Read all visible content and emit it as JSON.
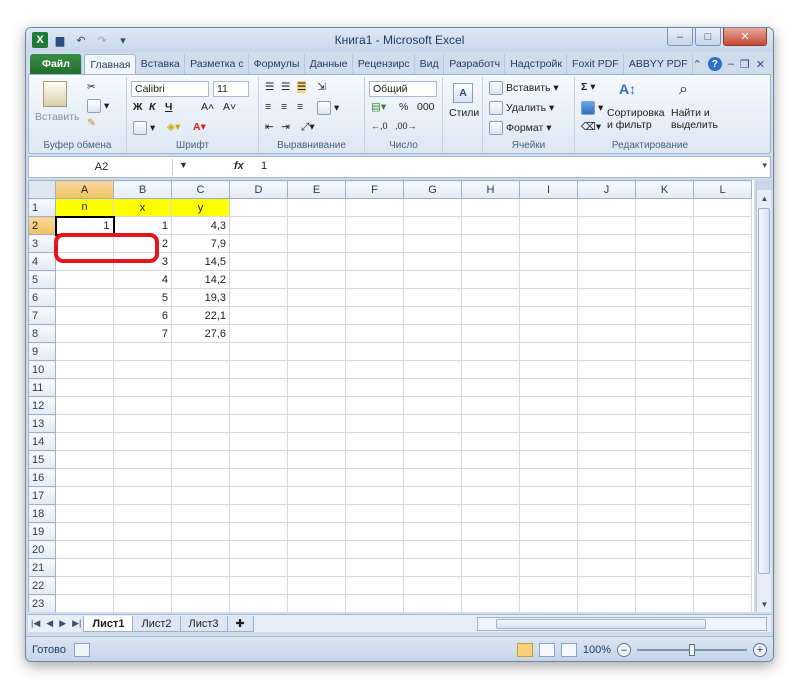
{
  "window": {
    "title": "Книга1 - Microsoft Excel",
    "app_icon": "X",
    "min": "–",
    "max": "□",
    "close": "✕"
  },
  "ribbon_tabs": [
    {
      "label": "Файл"
    },
    {
      "label": "Главная"
    },
    {
      "label": "Вставка"
    },
    {
      "label": "Разметка с"
    },
    {
      "label": "Формулы"
    },
    {
      "label": "Данные"
    },
    {
      "label": "Рецензирс"
    },
    {
      "label": "Вид"
    },
    {
      "label": "Разработч"
    },
    {
      "label": "Надстройк"
    },
    {
      "label": "Foxit PDF"
    },
    {
      "label": "ABBYY PDF"
    }
  ],
  "ribbon": {
    "clipboard": {
      "paste": "Вставить",
      "label": "Буфер обмена"
    },
    "font": {
      "name": "Calibri",
      "size": "11",
      "bold": "Ж",
      "italic": "К",
      "underline": "Ч",
      "grow": "A˄",
      "shrink": "A˅",
      "label": "Шрифт"
    },
    "alignment": {
      "label": "Выравнивание"
    },
    "number": {
      "format": "Общий",
      "percent": "%",
      "thousands": "000",
      "label": "Число"
    },
    "styles": {
      "label": "Стили"
    },
    "cells": {
      "insert": "Вставить",
      "delete": "Удалить",
      "format": "Формат",
      "label": "Ячейки"
    },
    "editing": {
      "sigma": "Σ",
      "sort": "Сортировка",
      "sort2": "и фильтр",
      "find": "Найти и",
      "find2": "выделить",
      "label": "Редактирование"
    }
  },
  "formula_bar": {
    "name_box": "A2",
    "fx": "fx",
    "value": "1"
  },
  "sheet": {
    "columns": [
      "A",
      "B",
      "C",
      "D",
      "E",
      "F",
      "G",
      "H",
      "I",
      "J",
      "K",
      "L"
    ],
    "headers": {
      "A1": "n",
      "B1": "x",
      "C1": "y"
    },
    "rows": [
      {
        "n": "1",
        "x": "1",
        "y": "4,3"
      },
      {
        "n": "",
        "x": "2",
        "y": "7,9"
      },
      {
        "n": "",
        "x": "3",
        "y": "14,5"
      },
      {
        "n": "",
        "x": "4",
        "y": "14,2"
      },
      {
        "n": "",
        "x": "5",
        "y": "19,3"
      },
      {
        "n": "",
        "x": "6",
        "y": "22,1"
      },
      {
        "n": "",
        "x": "7",
        "y": "27,6"
      }
    ],
    "row_count": 24,
    "highlight_color": "#ffff00",
    "ring_color": "#e8141b"
  },
  "sheet_tabs": [
    {
      "label": "Лист1"
    },
    {
      "label": "Лист2"
    },
    {
      "label": "Лист3"
    }
  ],
  "status": {
    "ready": "Готово",
    "zoom": "100%"
  }
}
